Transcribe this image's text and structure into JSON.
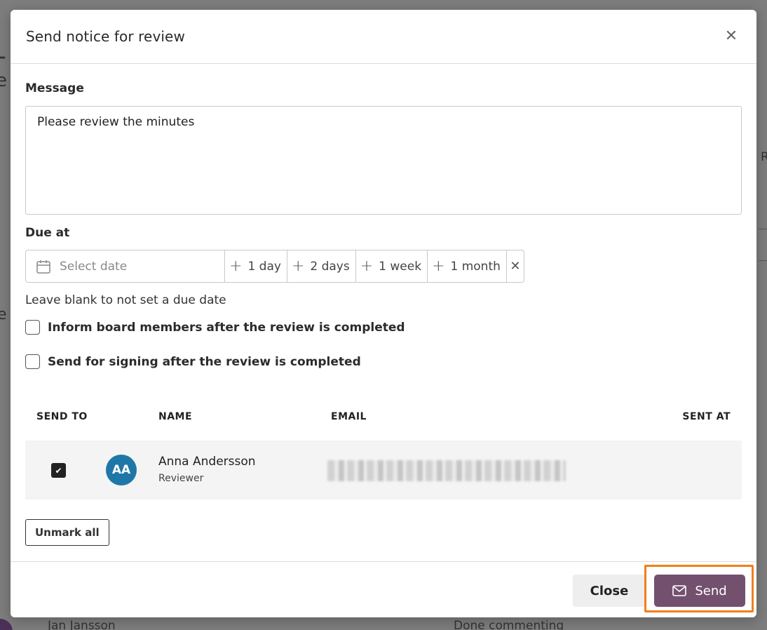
{
  "modal": {
    "title": "Send notice for review",
    "close_icon": "close-icon"
  },
  "message": {
    "label": "Message",
    "value": "Please review the minutes"
  },
  "due": {
    "label": "Due at",
    "placeholder": "Select date",
    "quick_options": [
      "1 day",
      "2 days",
      "1 week",
      "1 month"
    ],
    "clear_symbol": "✕",
    "hint": "Leave blank to not set a due date"
  },
  "options": {
    "inform_board": "Inform board members after the review is completed",
    "send_for_signing": "Send for signing after the review is completed"
  },
  "table": {
    "headers": {
      "send_to": "SEND TO",
      "name": "NAME",
      "email": "EMAIL",
      "sent_at": "SENT AT"
    },
    "rows": [
      {
        "checked": true,
        "initials": "AA",
        "name": "Anna Andersson",
        "role": "Reviewer",
        "email": "",
        "sent_at": ""
      }
    ]
  },
  "actions": {
    "unmark_all": "Unmark all",
    "close": "Close",
    "send": "Send"
  },
  "background": {
    "row_name": "Jan Jansson",
    "row_status": "Done commenting"
  },
  "colors": {
    "send_button": "#74506f",
    "avatar": "#1f77a8",
    "highlight": "#f07f1c"
  }
}
